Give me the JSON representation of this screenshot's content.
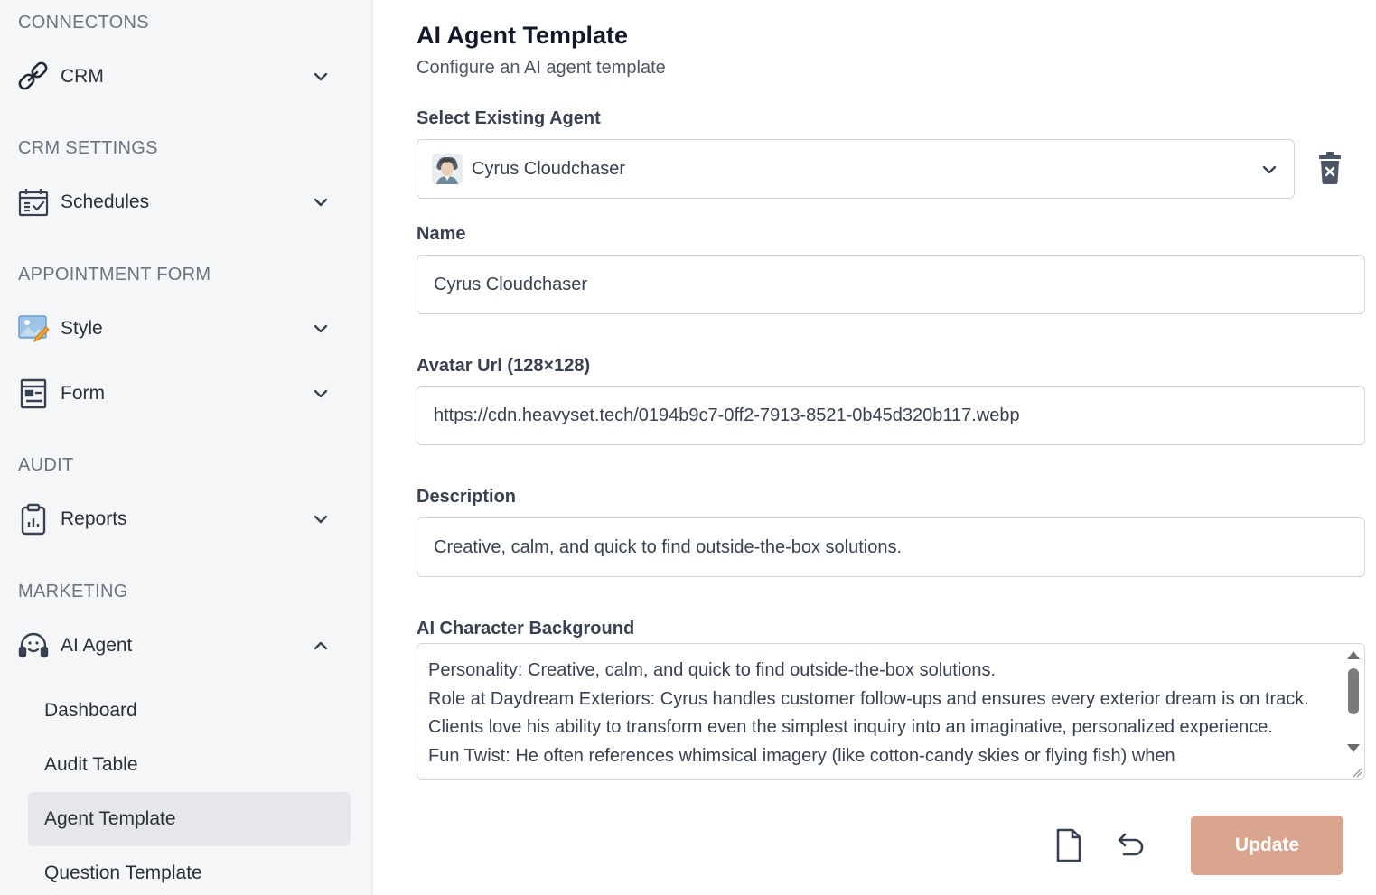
{
  "sidebar": {
    "sections": [
      {
        "title": "CONNECTONS"
      },
      {
        "title": "CRM SETTINGS"
      },
      {
        "title": "APPOINTMENT FORM"
      },
      {
        "title": "AUDIT"
      },
      {
        "title": "MARKETING"
      }
    ],
    "items": {
      "crm": {
        "label": "CRM",
        "icon": "link-icon",
        "expanded": false
      },
      "schedules": {
        "label": "Schedules",
        "icon": "calendar-check-icon",
        "expanded": false
      },
      "style": {
        "label": "Style",
        "icon": "image-edit-icon",
        "expanded": false
      },
      "form": {
        "label": "Form",
        "icon": "form-icon",
        "expanded": false
      },
      "reports": {
        "label": "Reports",
        "icon": "clipboard-chart-icon",
        "expanded": false
      },
      "ai_agent": {
        "label": "AI Agent",
        "icon": "headset-icon",
        "expanded": true
      }
    },
    "ai_agent_subitems": [
      {
        "label": "Dashboard",
        "active": false
      },
      {
        "label": "Audit Table",
        "active": false
      },
      {
        "label": "Agent Template",
        "active": true
      },
      {
        "label": "Question Template",
        "active": false
      }
    ]
  },
  "main": {
    "title": "AI Agent Template",
    "subtitle": "Configure an AI agent template",
    "select_agent": {
      "label": "Select Existing Agent",
      "value": "Cyrus Cloudchaser"
    },
    "name": {
      "label": "Name",
      "value": "Cyrus Cloudchaser"
    },
    "avatar_url": {
      "label": "Avatar Url (128×128)",
      "value": "https://cdn.heavyset.tech/0194b9c7-0ff2-7913-8521-0b45d320b117.webp"
    },
    "description": {
      "label": "Description",
      "value": "Creative, calm, and quick to find outside-the-box solutions."
    },
    "background": {
      "label": "AI Character Background",
      "value": "Personality: Creative, calm, and quick to find outside-the-box solutions.\nRole at Daydream Exteriors: Cyrus handles customer follow-ups and ensures every exterior dream is on track. Clients love his ability to transform even the simplest inquiry into an imaginative, personalized experience.\nFun Twist: He often references whimsical imagery (like cotton-candy skies or flying fish) when"
    },
    "actions": {
      "update_label": "Update"
    }
  },
  "colors": {
    "sidebar_bg": "#f5f6f7",
    "active_item_bg": "#e5e7eb",
    "update_button": "#d9a58e"
  }
}
